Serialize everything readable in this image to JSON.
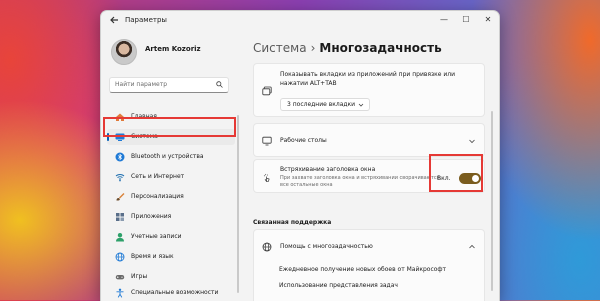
{
  "window": {
    "title": "Параметры",
    "minimize": "—",
    "maximize": "☐",
    "close": "✕"
  },
  "user": {
    "name": "Artem Kozoriz"
  },
  "search": {
    "placeholder": "Найти параметр"
  },
  "sidebar": {
    "items": [
      {
        "label": "Главная",
        "icon": "home-icon",
        "color": "#e07a3a"
      },
      {
        "label": "Система",
        "icon": "system-icon",
        "color": "#1f7ad6",
        "active": true
      },
      {
        "label": "Bluetooth и устройства",
        "icon": "bluetooth-icon",
        "color": "#1f7ad6"
      },
      {
        "label": "Сеть и Интернет",
        "icon": "network-icon",
        "color": "#1f6fb0"
      },
      {
        "label": "Персонализация",
        "icon": "brush-icon",
        "color": "#d9823a"
      },
      {
        "label": "Приложения",
        "icon": "apps-icon",
        "color": "#5a6f8a"
      },
      {
        "label": "Учетные записи",
        "icon": "accounts-icon",
        "color": "#2ea06a"
      },
      {
        "label": "Время и язык",
        "icon": "globe-icon",
        "color": "#1f7ad6"
      },
      {
        "label": "Игры",
        "icon": "gamepad-icon",
        "color": "#6a6a6a"
      },
      {
        "label": "Специальные возможности",
        "icon": "accessibility-icon",
        "color": "#1f7ad6"
      }
    ]
  },
  "breadcrumb": {
    "parent": "Система",
    "separator": "›",
    "current": "Многозадачность"
  },
  "cards": {
    "tabs": {
      "title": "Показывать вкладки из приложений при привязке или нажатии ALT+TAB",
      "dropdown_value": "3 последние вкладки"
    },
    "desktops": {
      "title": "Рабочие столы"
    },
    "shake": {
      "title": "Встряхивание заголовка окна",
      "subtitle": "При захвате заголовка окна и встряхивании сворачиваются все остальные окна",
      "toggle_label": "Вкл.",
      "toggle_on": true
    }
  },
  "support": {
    "section_title": "Связанная поддержка",
    "help_title": "Помощь с многозадачностью",
    "links": [
      "Ежедневное получение новых обоев от Майкрософт",
      "Использование представления задач"
    ]
  },
  "colors": {
    "accent": "#7a5c1e",
    "highlight": "#e53935"
  }
}
